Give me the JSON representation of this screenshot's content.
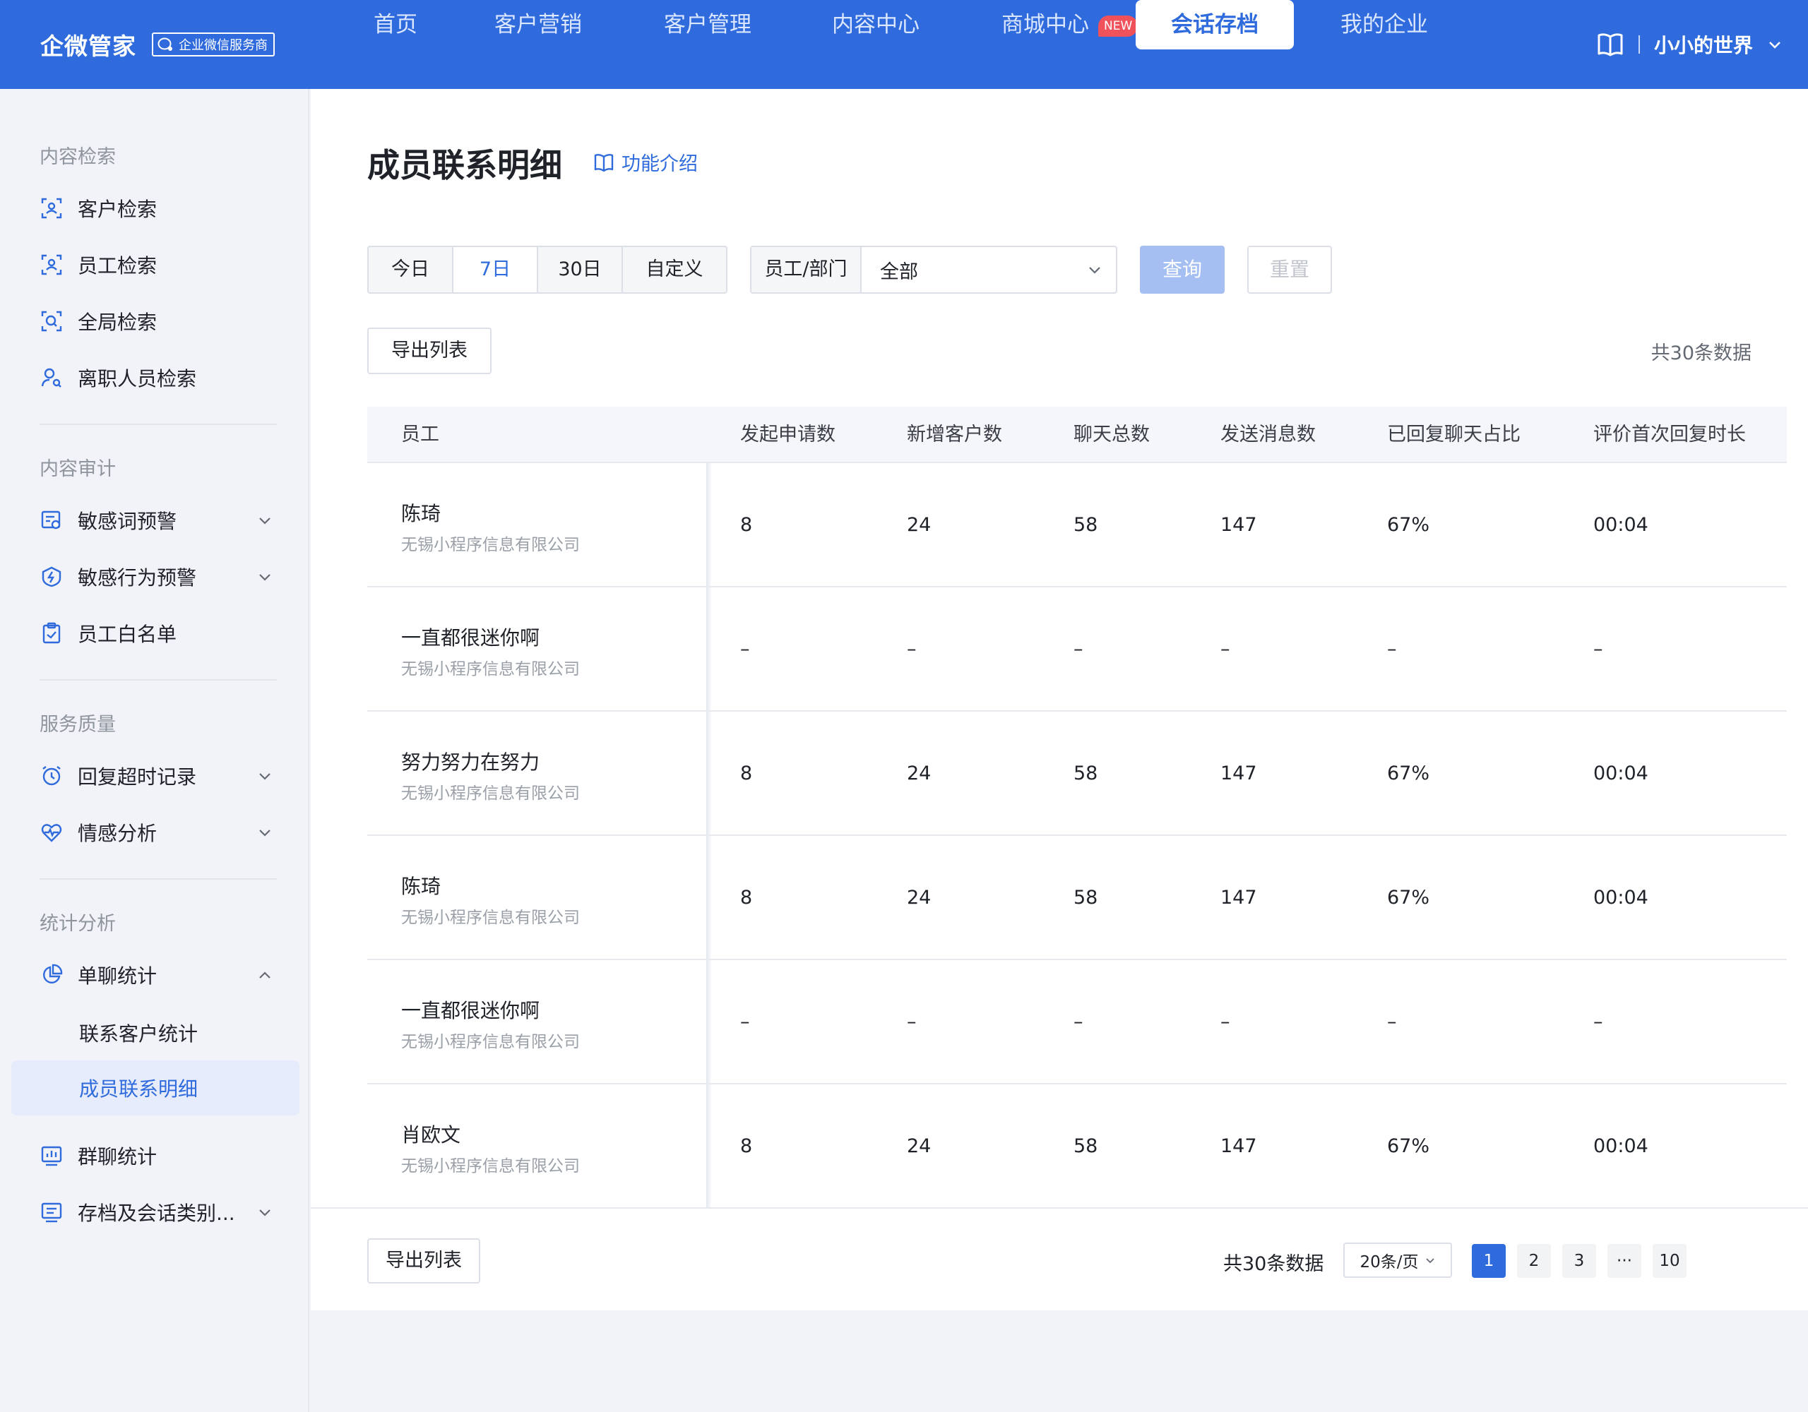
{
  "header": {
    "brand_name": "企微管家",
    "brand_badge": "企业微信服务商",
    "nav": [
      {
        "label": "首页"
      },
      {
        "label": "客户营销"
      },
      {
        "label": "客户管理"
      },
      {
        "label": "内容中心"
      },
      {
        "label": "商城中心"
      },
      {
        "label": "会话存档",
        "active": true
      },
      {
        "label": "我的企业"
      }
    ],
    "new_badge": "NEW",
    "user_name": "小小的世界",
    "brand_color": "#2f6bdc"
  },
  "sidebar": {
    "groups": [
      {
        "title": "内容检索",
        "items": [
          {
            "label": "客户检索",
            "icon": "customer-search-icon"
          },
          {
            "label": "员工检索",
            "icon": "employee-search-icon"
          },
          {
            "label": "全局检索",
            "icon": "global-search-icon"
          },
          {
            "label": "离职人员检索",
            "icon": "resigned-search-icon"
          }
        ]
      },
      {
        "title": "内容审计",
        "items": [
          {
            "label": "敏感词预警",
            "icon": "sensitive-word-icon"
          },
          {
            "label": "敏感行为预警",
            "icon": "sensitive-behavior-icon"
          },
          {
            "label": "员工白名单",
            "icon": "whitelist-icon"
          }
        ]
      },
      {
        "title": "服务质量",
        "items": [
          {
            "label": "回复超时记录",
            "icon": "alarm-clock-icon"
          },
          {
            "label": "情感分析",
            "icon": "heart-pulse-icon"
          }
        ]
      },
      {
        "title": "统计分析",
        "items": [
          {
            "label": "单聊统计",
            "icon": "pie-chart-icon"
          },
          {
            "label": "联系客户统计"
          },
          {
            "label": "成员联系明细",
            "active": true
          },
          {
            "label": "群聊统计",
            "icon": "bar-chart-icon"
          },
          {
            "label": "存档及会话类别...",
            "icon": "archive-list-icon"
          }
        ]
      }
    ]
  },
  "main": {
    "title": "成员联系明细",
    "feature_link": "功能介绍",
    "date_tabs": [
      "今日",
      "7日",
      "30日",
      "自定义"
    ],
    "active_date_tab": "7日",
    "dept_label": "员工/部门",
    "dept_value": "全部",
    "query_button": "查询",
    "reset_button": "重置",
    "export_button": "导出列表",
    "total_text": "共30条数据",
    "table": {
      "columns": [
        "员工",
        "发起申请数",
        "新增客户数",
        "聊天总数",
        "发送消息数",
        "已回复聊天占比",
        "评价首次回复时长"
      ],
      "rows": [
        {
          "name": "陈琦",
          "org": "无锡小程序信息有限公司",
          "c1": "8",
          "c2": "24",
          "c3": "58",
          "c4": "147",
          "c5": "67%",
          "c6": "00:04"
        },
        {
          "name": "一直都很迷你啊",
          "org": "无锡小程序信息有限公司",
          "c1": "–",
          "c2": "–",
          "c3": "–",
          "c4": "–",
          "c5": "–",
          "c6": "–"
        },
        {
          "name": "努力努力在努力",
          "org": "无锡小程序信息有限公司",
          "c1": "8",
          "c2": "24",
          "c3": "58",
          "c4": "147",
          "c5": "67%",
          "c6": "00:04"
        },
        {
          "name": "陈琦",
          "org": "无锡小程序信息有限公司",
          "c1": "8",
          "c2": "24",
          "c3": "58",
          "c4": "147",
          "c5": "67%",
          "c6": "00:04"
        },
        {
          "name": "一直都很迷你啊",
          "org": "无锡小程序信息有限公司",
          "c1": "–",
          "c2": "–",
          "c3": "–",
          "c4": "–",
          "c5": "–",
          "c6": "–"
        },
        {
          "name": "肖欧文",
          "org": "无锡小程序信息有限公司",
          "c1": "8",
          "c2": "24",
          "c3": "58",
          "c4": "147",
          "c5": "67%",
          "c6": "00:04"
        }
      ]
    }
  },
  "footer": {
    "export_button": "导出列表",
    "total_text": "共30条数据",
    "page_size": "20条/页",
    "pages": [
      "1",
      "2",
      "3",
      "···",
      "10"
    ],
    "current_page": "1"
  }
}
